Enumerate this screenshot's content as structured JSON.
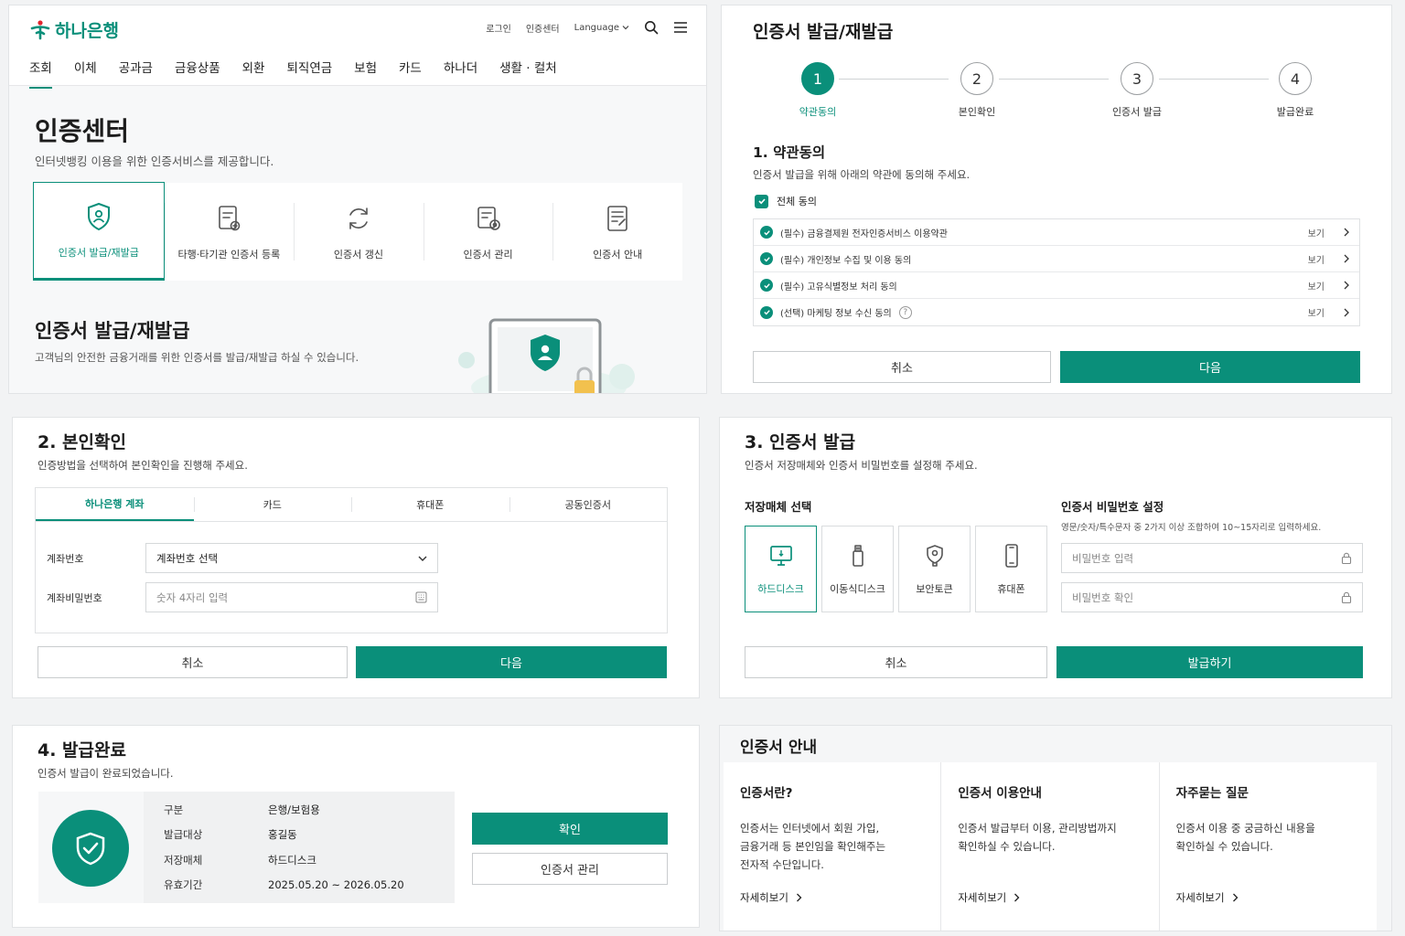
{
  "colors": {
    "brand": "#0a8f7a",
    "border": "#dfe1e3"
  },
  "header": {
    "logo": "하나은행",
    "util": [
      "로그인",
      "인증센터"
    ],
    "language": "Language",
    "nav": [
      "조회",
      "이체",
      "공과금",
      "금융상품",
      "외환",
      "퇴직연금",
      "보험",
      "카드",
      "하나더",
      "생활 · 컬처"
    ]
  },
  "cert_center": {
    "title": "인증센터",
    "subtitle": "인터넷뱅킹 이용을 위한 인증서비스를 제공합니다.",
    "menu": [
      {
        "label": "인증서 발급/재발급",
        "icon": "shield-user-icon"
      },
      {
        "label": "타행·타기관 인증서 등록",
        "icon": "document-register-icon"
      },
      {
        "label": "인증서 갱신",
        "icon": "refresh-icon"
      },
      {
        "label": "인증서 관리",
        "icon": "certificate-manage-icon"
      },
      {
        "label": "인증서 안내",
        "icon": "document-guide-icon"
      }
    ],
    "section_title": "인증서 발급/재발급",
    "section_sub": "고객님의 안전한 금융거래를 위한 인증서를 발급/재발급 하실 수 있습니다."
  },
  "issue": {
    "title": "인증서 발급/재발급",
    "steps": [
      {
        "num": "1",
        "label": "약관동의"
      },
      {
        "num": "2",
        "label": "본인확인"
      },
      {
        "num": "3",
        "label": "인증서 발급"
      },
      {
        "num": "4",
        "label": "발급완료"
      }
    ],
    "step1_title": "1. 약관동의",
    "step1_desc": "인증서 발급을 위해 아래의 약관에 동의해 주세요.",
    "agree_all": "전체 동의",
    "terms": [
      {
        "label": "(필수) 금융결제원 전자인증서비스 이용약관",
        "view": "보기"
      },
      {
        "label": "(필수) 개인정보 수집 및 이용 동의",
        "view": "보기"
      },
      {
        "label": "(필수) 고유식별정보 처리 동의",
        "view": "보기"
      },
      {
        "label": "(선택) 마케팅 정보 수신 동의",
        "view": "보기"
      }
    ],
    "cancel": "취소",
    "next": "다음"
  },
  "verify": {
    "title": "2. 본인확인",
    "desc": "인증방법을 선택하여 본인확인을 진행해 주세요.",
    "tabs": [
      "하나은행 계좌",
      "카드",
      "휴대폰",
      "공동인증서"
    ],
    "account_label": "계좌번호",
    "account_value": "계좌번호 선택",
    "pw_label": "계좌비밀번호",
    "pw_placeholder": "숫자 4자리 입력",
    "cancel": "취소",
    "next": "다음"
  },
  "cert_issue": {
    "title": "3. 인증서 발급",
    "desc": "인증서 저장매체와 인증서 비밀번호를 설정해 주세요.",
    "media_title": "저장매체 선택",
    "media": [
      {
        "label": "하드디스크",
        "icon": "monitor-icon"
      },
      {
        "label": "이동식디스크",
        "icon": "usb-icon"
      },
      {
        "label": "보안토큰",
        "icon": "token-icon"
      },
      {
        "label": "휴대폰",
        "icon": "phone-icon"
      }
    ],
    "pw_title": "인증서 비밀번호 설정",
    "pw_note": "영문/숫자/특수문자 중 2가지 이상 조합하여 10~15자리로 입력하세요.",
    "pw_placeholder": "비밀번호 입력",
    "pw_confirm_placeholder": "비밀번호 확인",
    "cancel": "취소",
    "submit": "발급하기"
  },
  "complete": {
    "title": "4. 발급완료",
    "desc": "인증서 발급이 완료되었습니다.",
    "rows": [
      {
        "k": "구분",
        "v": "은행/보험용"
      },
      {
        "k": "발급대상",
        "v": "홍길동"
      },
      {
        "k": "저장매체",
        "v": "하드디스크"
      },
      {
        "k": "유효기간",
        "v": "2025.05.20 ~ 2026.05.20"
      }
    ],
    "confirm": "확인",
    "manage": "인증서 관리"
  },
  "guide": {
    "title": "인증서 안내",
    "cols": [
      {
        "title": "인증서란?",
        "text": "인증서는 인터넷에서 회원 가입,\n금융거래 등 본인임을 확인해주는\n전자적 수단입니다.",
        "more": "자세히보기"
      },
      {
        "title": "인증서 이용안내",
        "text": "인증서 발급부터 이용, 관리방법까지\n확인하실 수 있습니다.",
        "more": "자세히보기"
      },
      {
        "title": "자주묻는 질문",
        "text": "인증서 이용 중 궁금하신 내용을\n확인하실 수 있습니다.",
        "more": "자세히보기"
      }
    ]
  }
}
